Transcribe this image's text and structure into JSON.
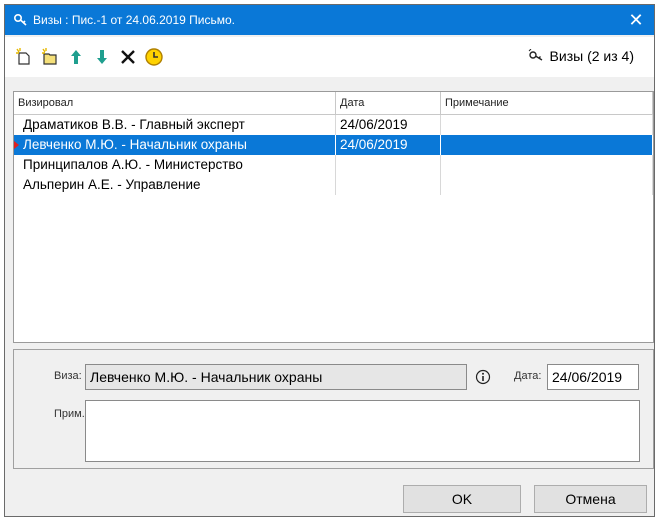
{
  "window": {
    "title": "Визы : Пис.-1 от 24.06.2019 Письмо.",
    "icon": "key-icon",
    "close_icon": "close-icon"
  },
  "toolbar": {
    "buttons": [
      {
        "name": "new-visa",
        "icon": "new-document-icon"
      },
      {
        "name": "new-visa-copy",
        "icon": "new-folder-icon"
      },
      {
        "name": "move-up",
        "icon": "arrow-up-icon"
      },
      {
        "name": "move-down",
        "icon": "arrow-down-icon"
      },
      {
        "name": "delete",
        "icon": "delete-x-icon"
      },
      {
        "name": "time",
        "icon": "clock-icon"
      }
    ],
    "visas_indicator": "Визы (2 из 4)"
  },
  "grid": {
    "columns": [
      "Визировал",
      "Дата",
      "Примечание"
    ],
    "rows": [
      {
        "signer": "Драматиков В.В. - Главный эксперт",
        "date": "24/06/2019",
        "note": ""
      },
      {
        "signer": "Левченко М.Ю. - Начальник охраны",
        "date": "24/06/2019",
        "note": ""
      },
      {
        "signer": "Принципалов А.Ю. - Министерство",
        "date": "",
        "note": ""
      },
      {
        "signer": "Альперин А.Е. - Управление",
        "date": "",
        "note": ""
      }
    ],
    "selected_index": 1
  },
  "detail": {
    "visa_label": "Виза:",
    "visa_value": "Левченко М.Ю. - Начальник охраны",
    "date_label": "Дата:",
    "date_value": "24/06/2019",
    "note_label": "Прим.:",
    "note_value": ""
  },
  "buttons": {
    "ok": "OK",
    "cancel": "Отмена"
  },
  "colors": {
    "titlebar": "#0a78d7",
    "selection": "#0a78d7",
    "row_marker": "#e02020"
  }
}
